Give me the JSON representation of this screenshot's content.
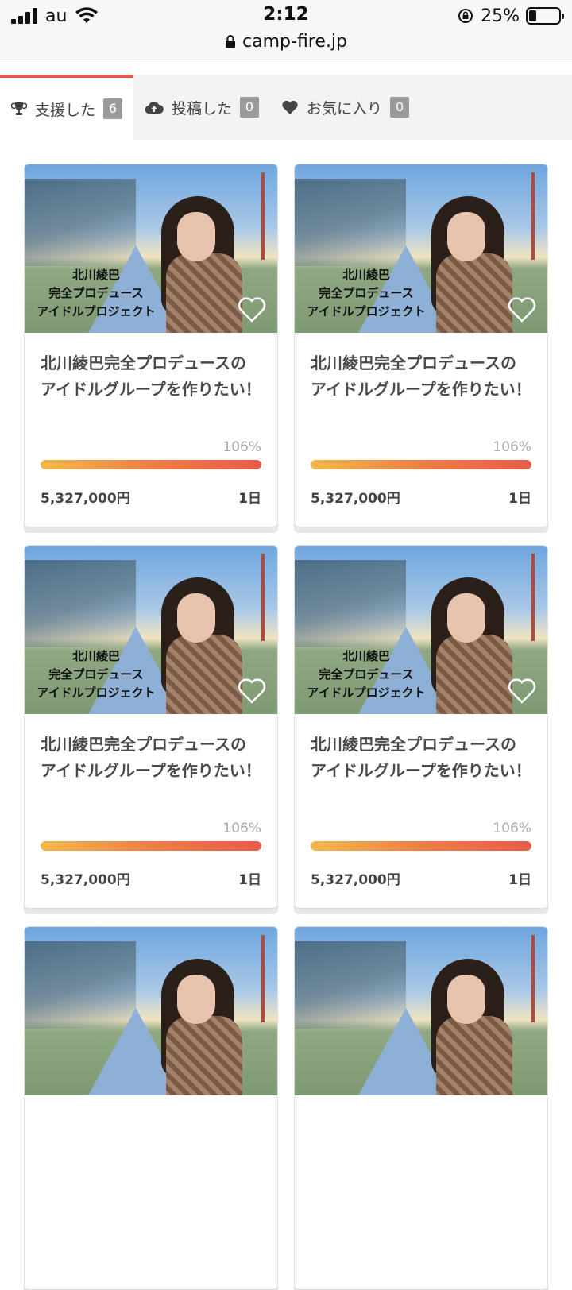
{
  "status_bar": {
    "carrier": "au",
    "time": "2:12",
    "battery": "25%",
    "battery_level": 0.25,
    "url": "camp-fire.jp"
  },
  "tabs": [
    {
      "icon": "trophy-icon",
      "label": "支援した",
      "count": "6",
      "active": true
    },
    {
      "icon": "cloud-upload-icon",
      "label": "投稿した",
      "count": "0",
      "active": false
    },
    {
      "icon": "heart-icon",
      "label": "お気に入り",
      "count": "0",
      "active": false
    }
  ],
  "colors": {
    "accent": "#e25a4f",
    "progress_start": "#f2b84b",
    "progress_end": "#ea5a4a"
  },
  "projects": [
    {
      "image_caption": [
        "北川綾巴",
        "完全プロデュース",
        "アイドルプロジェクト"
      ],
      "title": "北川綾巴完全プロデュースのアイドルグループを作りたい！",
      "percent": "106%",
      "progress": 1.06,
      "amount": "5,327,000円",
      "days": "1日"
    },
    {
      "image_caption": [
        "北川綾巴",
        "完全プロデュース",
        "アイドルプロジェクト"
      ],
      "title": "北川綾巴完全プロデュースのアイドルグループを作りたい！",
      "percent": "106%",
      "progress": 1.06,
      "amount": "5,327,000円",
      "days": "1日"
    },
    {
      "image_caption": [
        "北川綾巴",
        "完全プロデュース",
        "アイドルプロジェクト"
      ],
      "title": "北川綾巴完全プロデュースのアイドルグループを作りたい！",
      "percent": "106%",
      "progress": 1.06,
      "amount": "5,327,000円",
      "days": "1日"
    },
    {
      "image_caption": [
        "北川綾巴",
        "完全プロデュース",
        "アイドルプロジェクト"
      ],
      "title": "北川綾巴完全プロデュースのアイドルグループを作りたい！",
      "percent": "106%",
      "progress": 1.06,
      "amount": "5,327,000円",
      "days": "1日"
    },
    {
      "image_caption": [
        "",
        "",
        ""
      ],
      "title": "",
      "percent": "",
      "progress": 0,
      "amount": "",
      "days": ""
    },
    {
      "image_caption": [
        "",
        "",
        ""
      ],
      "title": "",
      "percent": "",
      "progress": 0,
      "amount": "",
      "days": ""
    }
  ]
}
